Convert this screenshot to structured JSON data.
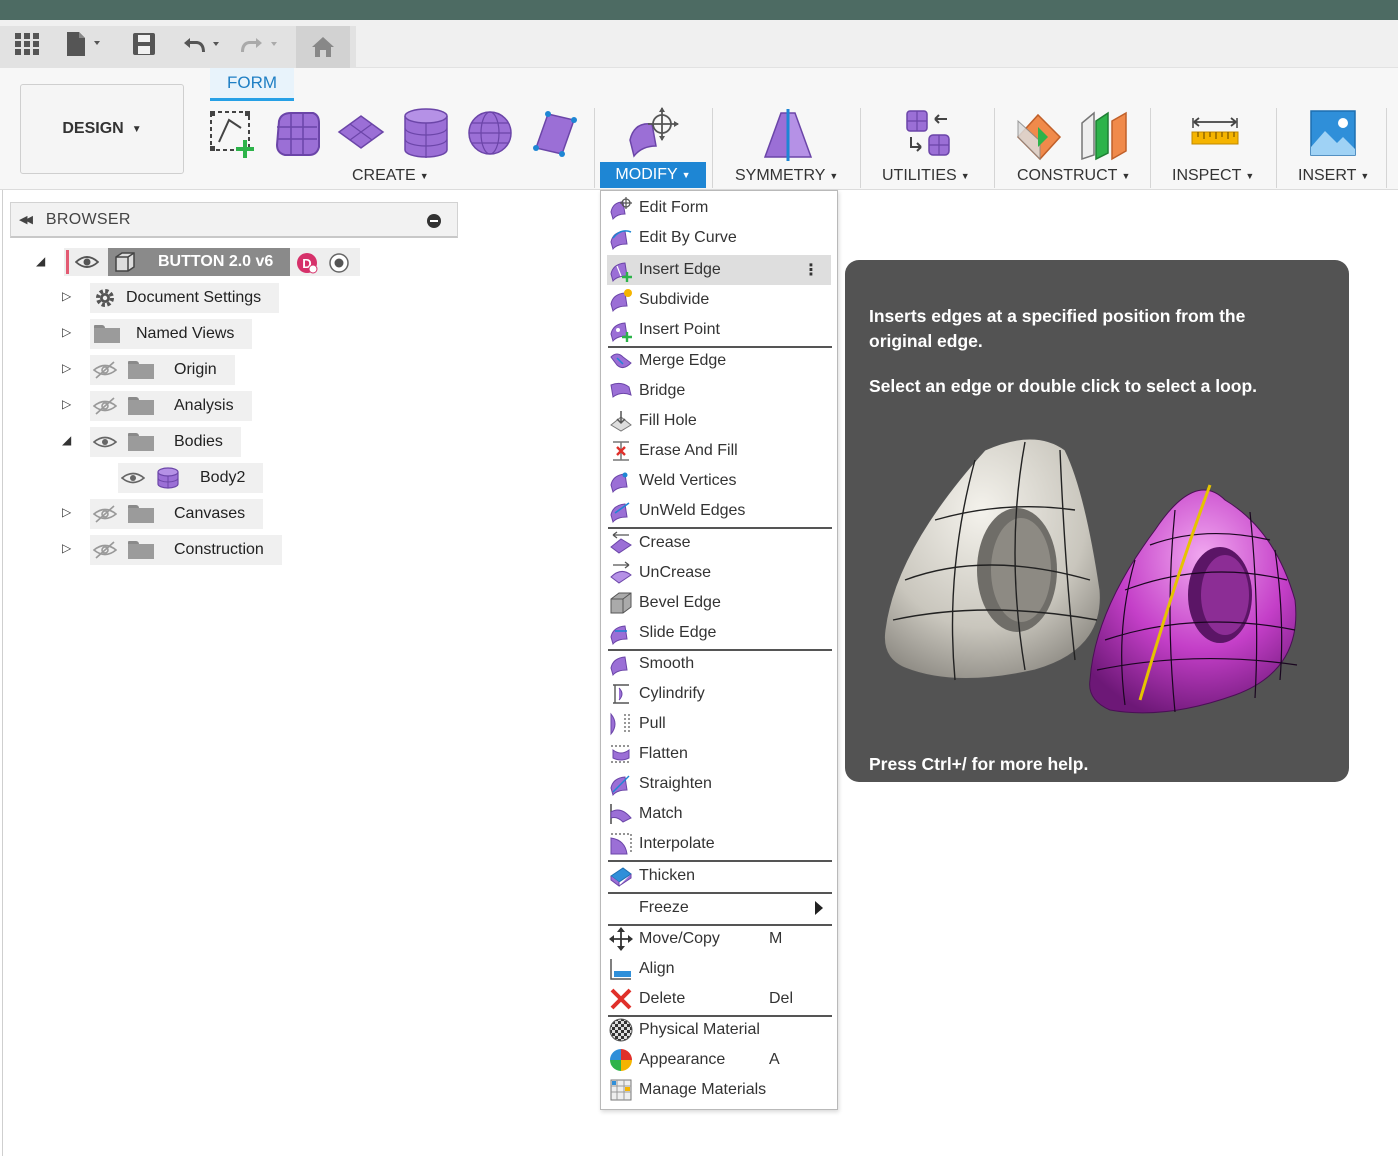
{
  "toolbar": {
    "design_label": "DESIGN",
    "form_tab": "FORM",
    "groups": {
      "create": "CREATE",
      "modify": "MODIFY",
      "symmetry": "SYMMETRY",
      "utilities": "UTILITIES",
      "construct": "CONSTRUCT",
      "inspect": "INSPECT",
      "insert": "INSERT"
    }
  },
  "browser": {
    "title": "BROWSER",
    "root": "BUTTON 2.0 v6",
    "items": [
      {
        "label": "Document Settings"
      },
      {
        "label": "Named Views"
      },
      {
        "label": "Origin"
      },
      {
        "label": "Analysis"
      },
      {
        "label": "Bodies"
      },
      {
        "label": "Body2"
      },
      {
        "label": "Canvases"
      },
      {
        "label": "Construction"
      }
    ]
  },
  "menu": {
    "items": [
      {
        "label": "Edit Form"
      },
      {
        "label": "Edit By Curve"
      },
      {
        "label": "Insert Edge"
      },
      {
        "label": "Subdivide"
      },
      {
        "label": "Insert Point"
      },
      {
        "label": "Merge Edge"
      },
      {
        "label": "Bridge"
      },
      {
        "label": "Fill Hole"
      },
      {
        "label": "Erase And Fill"
      },
      {
        "label": "Weld Vertices"
      },
      {
        "label": "UnWeld Edges"
      },
      {
        "label": "Crease"
      },
      {
        "label": "UnCrease"
      },
      {
        "label": "Bevel Edge"
      },
      {
        "label": "Slide Edge"
      },
      {
        "label": "Smooth"
      },
      {
        "label": "Cylindrify"
      },
      {
        "label": "Pull"
      },
      {
        "label": "Flatten"
      },
      {
        "label": "Straighten"
      },
      {
        "label": "Match"
      },
      {
        "label": "Interpolate"
      },
      {
        "label": "Thicken"
      },
      {
        "label": "Freeze"
      },
      {
        "label": "Move/Copy",
        "shortcut": "M"
      },
      {
        "label": "Align"
      },
      {
        "label": "Delete",
        "shortcut": "Del"
      },
      {
        "label": "Physical Material"
      },
      {
        "label": "Appearance",
        "shortcut": "A"
      },
      {
        "label": "Manage Materials"
      }
    ]
  },
  "tooltip": {
    "description": "Inserts edges at a specified position from the original edge.",
    "instruction": "Select an edge or double click to select a loop.",
    "help": "Press Ctrl+/ for more help."
  },
  "colors": {
    "accent_blue": "#1e86d4",
    "form_purple": "#9b6fd6",
    "title_strip": "#4d6b63",
    "tooltip_bg": "#535353"
  }
}
